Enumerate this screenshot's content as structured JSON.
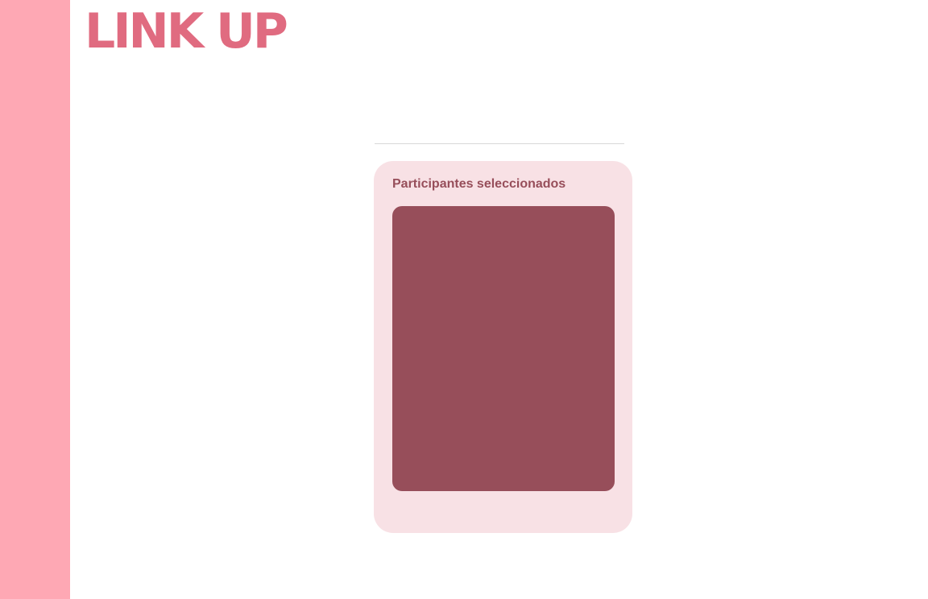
{
  "app": {
    "logo_text": "LINK UP"
  },
  "participants_panel": {
    "title": "Participantes seleccionados"
  },
  "colors": {
    "sidebar": "#fea8b4",
    "logo": "#e06b80",
    "panel_background": "#f8e1e5",
    "panel_title": "#974e5a",
    "list_background": "#974e5a",
    "divider": "#d9d9d9"
  }
}
